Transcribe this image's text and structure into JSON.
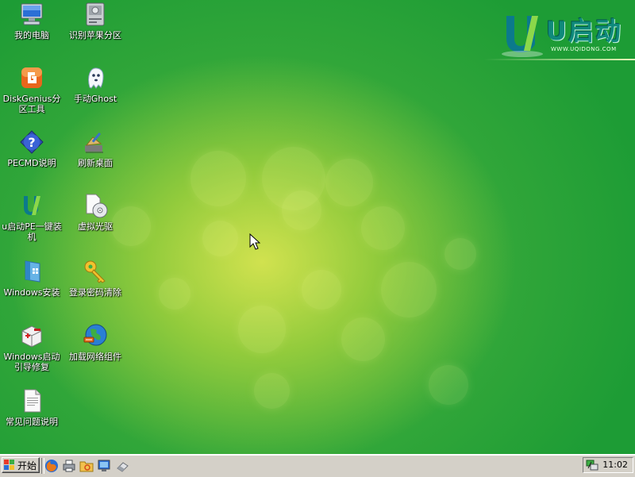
{
  "desktop": {
    "icons": [
      {
        "label": "我的电脑",
        "icon": "computer-icon"
      },
      {
        "label": "识别苹果分区",
        "icon": "disk-icon"
      },
      {
        "label": "DiskGenius分区工具",
        "icon": "diskgenius-icon"
      },
      {
        "label": "手动Ghost",
        "icon": "ghost-icon"
      },
      {
        "label": "PECMD说明",
        "icon": "help-icon"
      },
      {
        "label": "刷新桌面",
        "icon": "broom-icon"
      },
      {
        "label": "u启动PE一键装机",
        "icon": "u-logo-icon"
      },
      {
        "label": "虚拟光驱",
        "icon": "virtual-cd-icon"
      },
      {
        "label": "Windows安装",
        "icon": "windows-setup-icon"
      },
      {
        "label": "登录密码清除",
        "icon": "key-icon"
      },
      {
        "label": "Windows启动引导修复",
        "icon": "toolbox-icon"
      },
      {
        "label": "加载网络组件",
        "icon": "network-globe-icon"
      },
      {
        "label": "常见问题说明",
        "icon": "document-icon"
      }
    ]
  },
  "logo": {
    "brand": "U启动",
    "url": "WWW.UQIDONG.COM"
  },
  "taskbar": {
    "start_label": "开始",
    "quick_launch": [
      "firefox-icon",
      "printer-icon",
      "folder-icon",
      "display-icon",
      "eraser-icon"
    ],
    "tray": {
      "icon": "network-tray-icon",
      "clock": "11:02"
    }
  },
  "colors": {
    "desktop_green": "#2aa23a",
    "desktop_highlight": "#d7e450",
    "taskbar_gray": "#d4d0c8"
  }
}
